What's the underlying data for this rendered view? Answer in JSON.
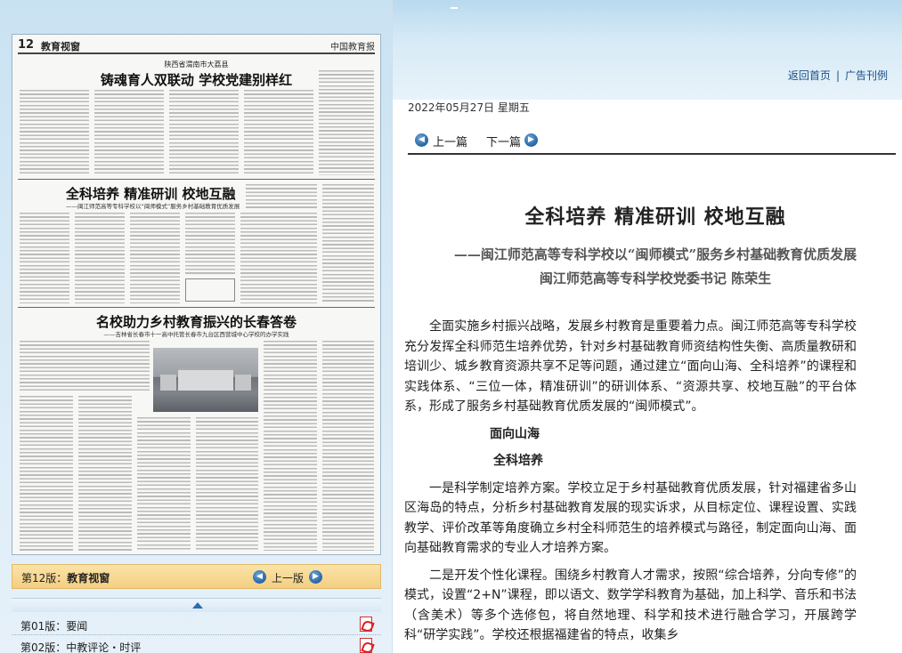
{
  "header": {
    "links": [
      "返回首页",
      "广告刊例"
    ],
    "separator": "|"
  },
  "newspaper": {
    "page_number": "12",
    "section": "教育视窗",
    "brand": "中国教育报",
    "kicker": "陕西省渭南市大荔县",
    "headline1": "铸魂育人双联动 学校党建别样红",
    "headline2": "全科培养 精准研训 校地互融",
    "headline2_sub": "——闽江师范高等专科学校以“闽师模式”服务乡村基础教育优质发展",
    "headline3": "名校助力乡村教育振兴的长春答卷",
    "headline3_sub": "——吉林省长春市十一高中托管长春市九台区西营城中心学校的办学实践"
  },
  "edition": {
    "label_prefix": "第12版：",
    "label_name": "教育视窗",
    "prev": "上一版",
    "prev_icon": "left-arrow-circle-icon",
    "next_icon": "right-arrow-circle-icon",
    "list": [
      {
        "prefix": "第01版：",
        "name": "要闻"
      },
      {
        "prefix": "第02版：",
        "name": "中教评论・时评"
      }
    ]
  },
  "date": "2022年05月27日 星期五",
  "article_nav": {
    "prev": "上一篇",
    "next": "下一篇"
  },
  "article": {
    "title": "全科培养 精准研训 校地互融",
    "subtitle": "——闽江师范高等专科学校以“闽师模式”服务乡村基础教育优质发展",
    "author": "闽江师范高等专科学校党委书记 陈荣生",
    "para1": "全面实施乡村振兴战略，发展乡村教育是重要着力点。闽江师范高等专科学校充分发挥全科师范生培养优势，针对乡村基础教育师资结构性失衡、高质量教研和培训少、城乡教育资源共享不足等问题，通过建立“面向山海、全科培养”的课程和实践体系、“三位一体，精准研训”的研训体系、“资源共享、校地互融”的平台体系，形成了服务乡村基础教育优质发展的“闽师模式”。",
    "heading1": "面向山海",
    "heading2": "全科培养",
    "para2": "一是科学制定培养方案。学校立足于乡村基础教育优质发展，针对福建省多山区海岛的特点，分析乡村基础教育发展的现实诉求，从目标定位、课程设置、实践教学、评价改革等角度确立乡村全科师范生的培养模式与路径，制定面向山海、面向基础教育需求的专业人才培养方案。",
    "para3": "二是开发个性化课程。围绕乡村教育人才需求，按照“综合培养，分向专修”的模式，设置“2+N”课程，即以语文、数学学科教育为基础，加上科学、音乐和书法（含美术）等多个选修包，将自然地理、科学和技术进行融合学习，开展跨学科“研学实践”。学校还根据福建省的特点，收集乡"
  },
  "colors": {
    "banner": "#c9e2f2",
    "edition_bar": "#f3cf82",
    "link": "#1a4f86",
    "nav_icon": "#2d6cad"
  }
}
